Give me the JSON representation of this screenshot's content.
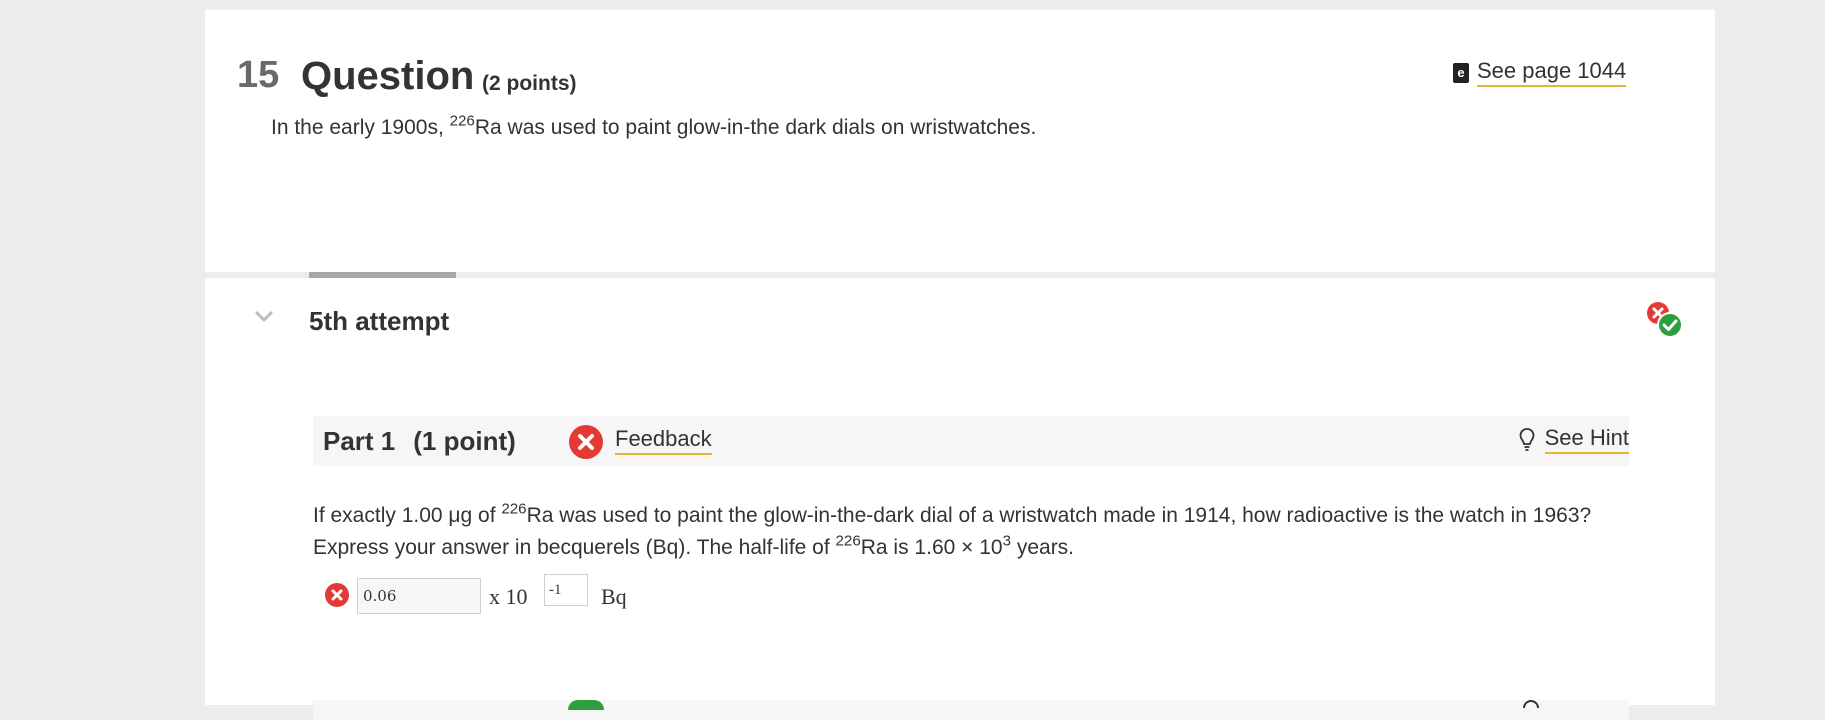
{
  "question": {
    "number": "15",
    "title": "Question",
    "points": "(2 points)",
    "see_page_label": "See page 1044",
    "text_before": "In the early 1900s, ",
    "isotope_mass": "226",
    "text_after": "Ra was used to paint glow-in-the dark dials on wristwatches."
  },
  "attempt": {
    "label": "5th attempt",
    "status_icons": [
      "incorrect-icon",
      "correct-icon"
    ]
  },
  "part1": {
    "title": "Part 1",
    "points": "(1 point)",
    "feedback_label": "Feedback",
    "hint_label": "See Hint",
    "body": {
      "p1": "If exactly 1.00 μg of ",
      "mass1": "226",
      "p2": "Ra was used to paint the glow-in-the-dark dial of a wristwatch made in 1914, how radioactive is the watch in 1963? Express your answer in becquerels (Bq). The half-life of ",
      "mass2": "226",
      "p3": "Ra is 1.60 × 10",
      "exp": "3",
      "p4": " years."
    },
    "answer": {
      "value": "0.06",
      "times_ten": "x 10",
      "exponent": "-1",
      "unit": "Bq",
      "status": "incorrect"
    }
  },
  "colors": {
    "incorrect": "#e53935",
    "correct": "#2e9e3e",
    "link_underline": "#e0b436"
  }
}
